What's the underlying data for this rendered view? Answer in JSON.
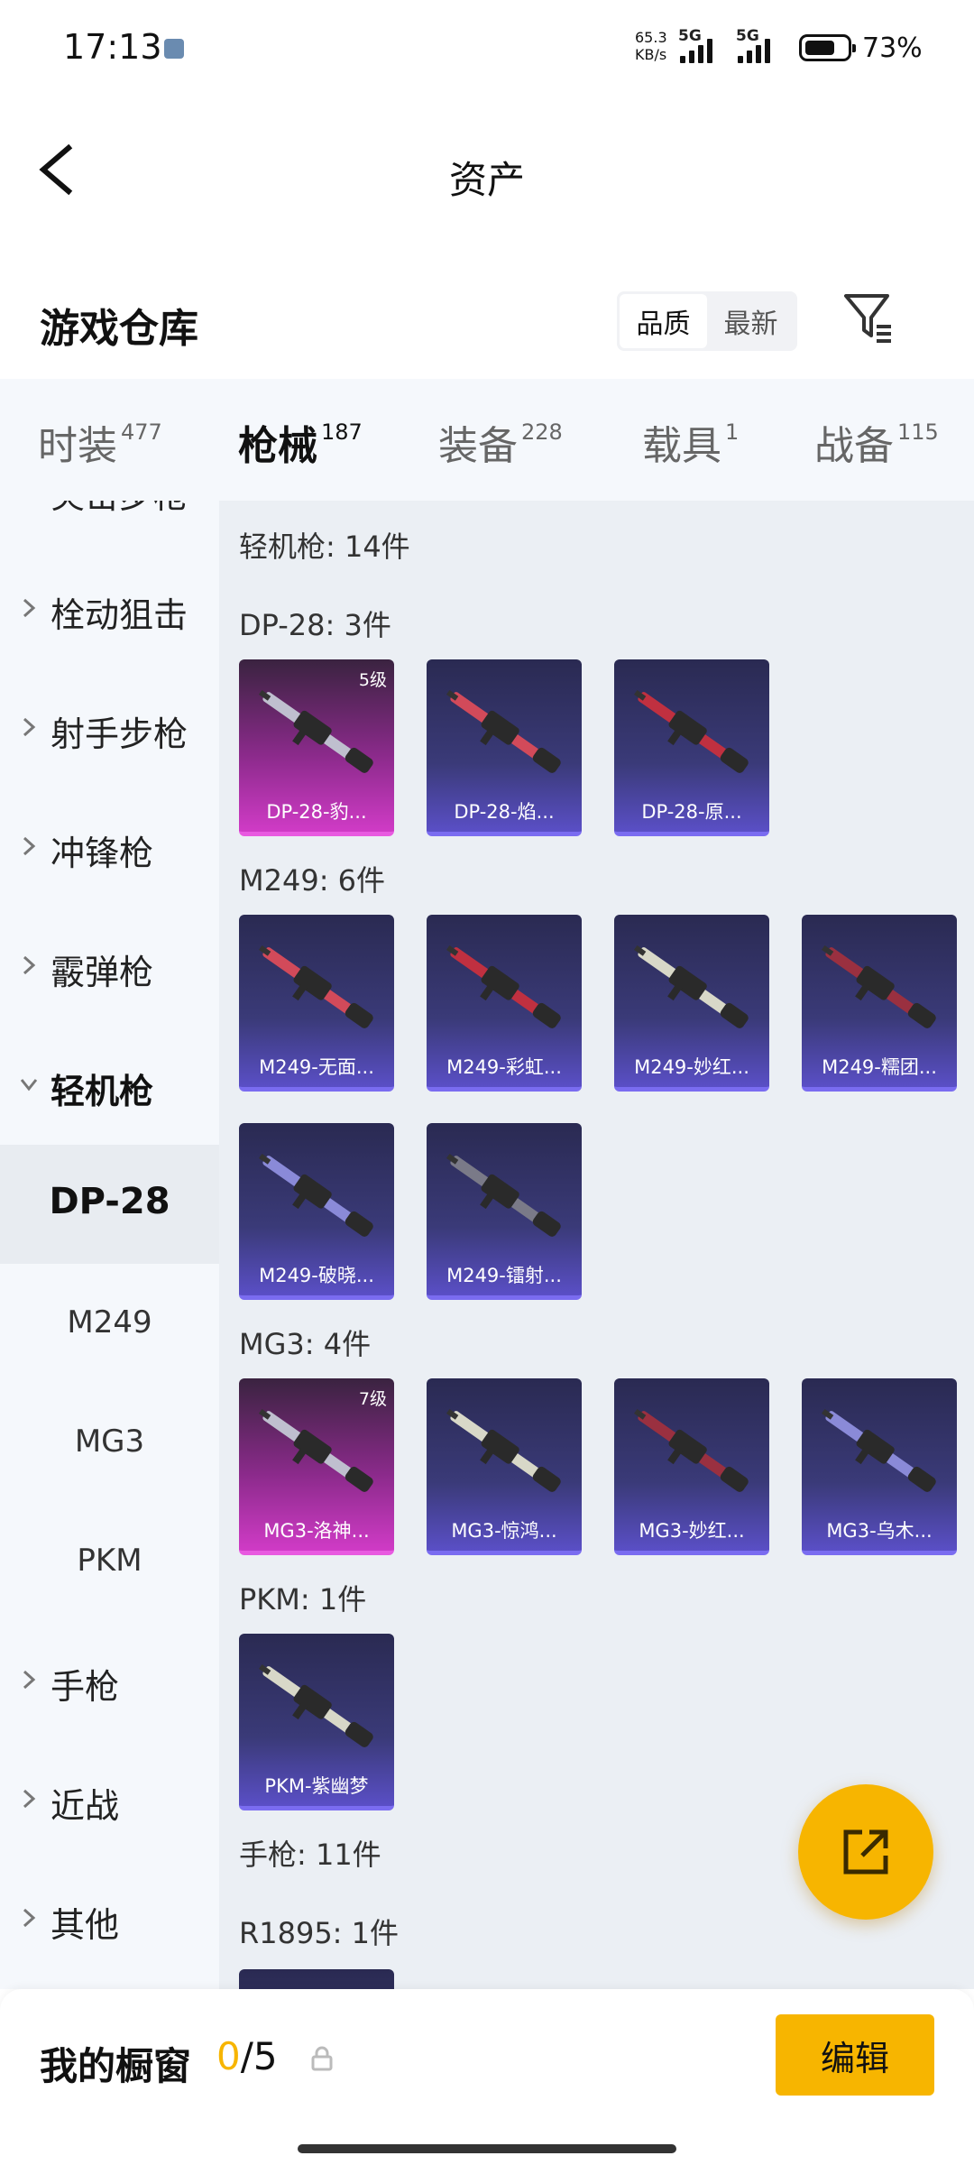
{
  "status_bar": {
    "time": "17:13",
    "net_speed_value": "65.3",
    "net_speed_unit": "KB/s",
    "sim1_label": "5G",
    "sim2_label": "5G",
    "battery_percent": "73%",
    "battery_level": 0.73
  },
  "nav": {
    "title": "资产"
  },
  "warehouse": {
    "title": "游戏仓库",
    "sort_options": [
      "品质",
      "最新"
    ],
    "sort_selected": "品质"
  },
  "tabs": [
    {
      "label": "时装",
      "count": "477"
    },
    {
      "label": "枪械",
      "count": "187",
      "active": true
    },
    {
      "label": "装备",
      "count": "228"
    },
    {
      "label": "载具",
      "count": "1"
    },
    {
      "label": "战备",
      "count": "115"
    }
  ],
  "sidebar": [
    {
      "label": "突击步枪",
      "type": "group"
    },
    {
      "label": "栓动狙击",
      "type": "group"
    },
    {
      "label": "射手步枪",
      "type": "group"
    },
    {
      "label": "冲锋枪",
      "type": "group"
    },
    {
      "label": "霰弹枪",
      "type": "group"
    },
    {
      "label": "轻机枪",
      "type": "group-open"
    },
    {
      "label": "DP-28",
      "type": "sub-active"
    },
    {
      "label": "M249",
      "type": "sub"
    },
    {
      "label": "MG3",
      "type": "sub"
    },
    {
      "label": "PKM",
      "type": "sub"
    },
    {
      "label": "手枪",
      "type": "group"
    },
    {
      "label": "近战",
      "type": "group"
    },
    {
      "label": "其他",
      "type": "group"
    }
  ],
  "content": {
    "category_header": "轻机枪: 14件",
    "groups": [
      {
        "header": "DP-28: 3件",
        "items": [
          {
            "name": "DP-28-豹...",
            "level": "5级",
            "tier": "gold"
          },
          {
            "name": "DP-28-焰...",
            "tier": "purple"
          },
          {
            "name": "DP-28-原...",
            "tier": "purple"
          }
        ]
      },
      {
        "header": "M249: 6件",
        "items": [
          {
            "name": "M249-无面...",
            "tier": "purple"
          },
          {
            "name": "M249-彩虹...",
            "tier": "purple"
          },
          {
            "name": "M249-妙红...",
            "tier": "purple"
          },
          {
            "name": "M249-糯团...",
            "tier": "purple"
          },
          {
            "name": "M249-破晓...",
            "tier": "purple"
          },
          {
            "name": "M249-镭射...",
            "tier": "purple"
          }
        ]
      },
      {
        "header": "MG3: 4件",
        "items": [
          {
            "name": "MG3-洛神...",
            "level": "7级",
            "tier": "gold"
          },
          {
            "name": "MG3-惊鸿...",
            "tier": "purple"
          },
          {
            "name": "MG3-妙红...",
            "tier": "purple"
          },
          {
            "name": "MG3-乌木...",
            "tier": "purple"
          }
        ]
      },
      {
        "header": "PKM: 1件",
        "items": [
          {
            "name": "PKM-紫幽梦",
            "tier": "purple"
          }
        ]
      }
    ],
    "next_category_header": "手枪: 11件",
    "next_group_header": "R1895: 1件"
  },
  "bottom_bar": {
    "title": "我的橱窗",
    "count_current": "0",
    "count_sep": "/",
    "count_total": "5",
    "edit_label": "编辑"
  },
  "colors": {
    "accent": "#f7b500",
    "tab_bg": "#f5f8fc",
    "content_bg": "#ebeff4",
    "card_purple": "#3a3a78",
    "card_gold": "#d03bc6"
  }
}
